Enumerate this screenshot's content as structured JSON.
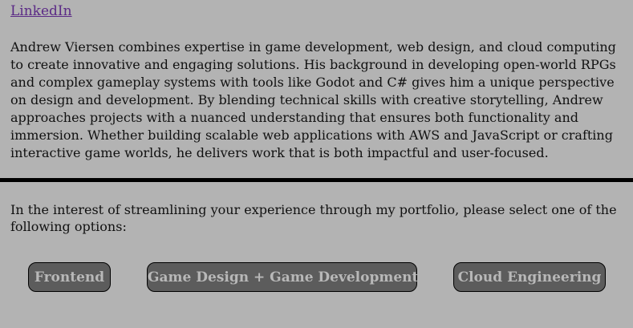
{
  "links": {
    "linkedin": "LinkedIn"
  },
  "bio": {
    "text": "Andrew Viersen combines expertise in game development, web design, and cloud computing to create innovative and engaging solutions. His background in developing open-world RPGs and complex gameplay systems with tools like Godot and C# gives him a unique perspective on design and development. By blending technical skills with creative storytelling, Andrew approaches projects with a nuanced understanding that ensures both functionality and immersion. Whether building scalable web applications with AWS and JavaScript or crafting interactive game worlds, he delivers work that is both impactful and user-focused."
  },
  "intro": {
    "text": "In the interest of streamlining your experience through my portfolio, please select one of the following options:"
  },
  "options": [
    {
      "label": "Frontend"
    },
    {
      "label": "Game Design + Game Development"
    },
    {
      "label": "Cloud Engineering"
    }
  ],
  "colors": {
    "background": "#b3b3b3",
    "link": "#5b2a86",
    "button_bg": "#5c5c5c",
    "button_text": "#b8b8b8",
    "divider": "#000000"
  }
}
